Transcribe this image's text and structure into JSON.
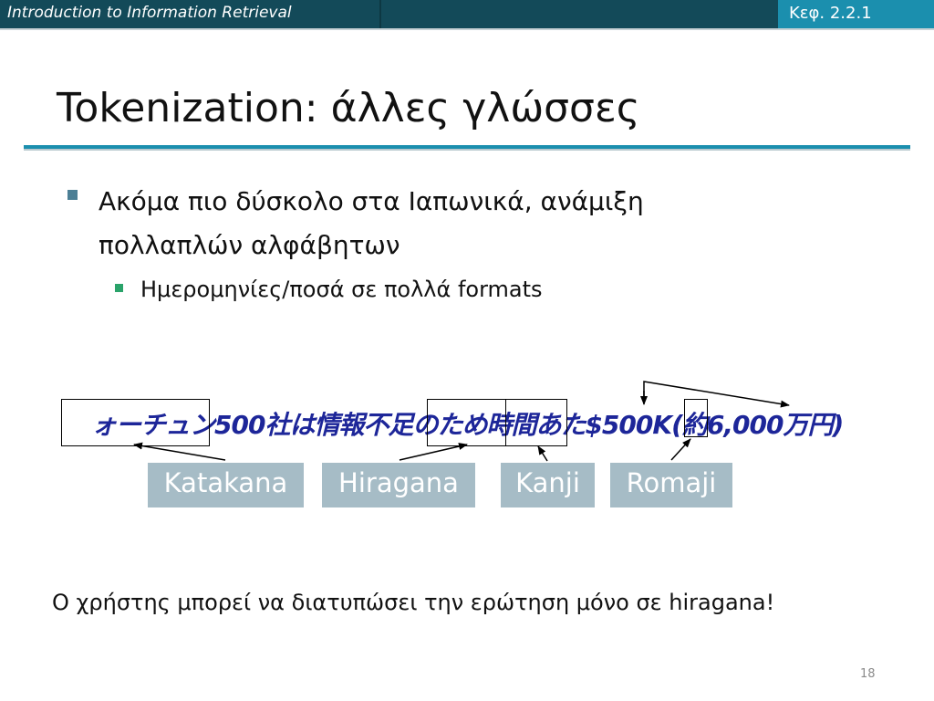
{
  "header": {
    "course_title": "Introduction to Information Retrieval",
    "section_ref": "Κεφ. 2.2.1"
  },
  "title": "Tokenization: άλλες γλώσσες",
  "bullets": [
    {
      "text": "Ακόμα πιο δύσκολο στα Ιαπωνικά, ανάμιξη πολλαπλών αλφάβητων",
      "sub": [
        {
          "text": "Ημερομηνίες/ποσά σε πολλά formats"
        }
      ]
    }
  ],
  "example": {
    "japanese_text": "ォーチュン500社は情報不足のため時間あた$500K(約6,000万円)",
    "labels": [
      "Katakana",
      "Hiragana",
      "Kanji",
      "Romaji"
    ]
  },
  "note": "Ο χρήστης μπορεί να διατυπώσει την ερώτηση μόνο σε hiragana!",
  "page_number": "18",
  "colors": {
    "header_bar": "#134a59",
    "section_tab": "#1b8fae",
    "title_rule": "#1b8fae",
    "label_bg": "#a6bcc6",
    "japanese_text": "#1d2699"
  }
}
